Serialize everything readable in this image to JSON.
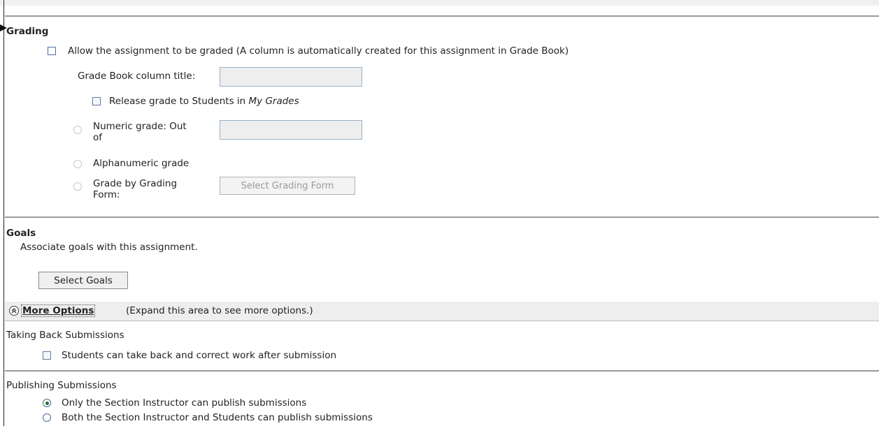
{
  "grading": {
    "heading": "Grading",
    "allow_label": "Allow the assignment to be graded (A column is automatically created for this assignment in Grade Book)",
    "column_title_label": "Grade Book column title:",
    "column_title_value": "",
    "release_prefix": "Release grade to Students in ",
    "release_italic": "My Grades",
    "numeric_line1": "Numeric grade: Out",
    "numeric_line2": "of",
    "numeric_value": "",
    "alphanumeric_label": "Alphanumeric grade",
    "grading_form_line1": "Grade by Grading",
    "grading_form_line2": "Form:",
    "select_grading_form_button": "Select Grading Form"
  },
  "goals": {
    "heading": "Goals",
    "description": "Associate goals with this assignment.",
    "select_goals_button": "Select Goals"
  },
  "more_options": {
    "link": "More Options",
    "note": "(Expand this area to see more options.)"
  },
  "taking_back": {
    "heading": "Taking Back Submissions",
    "checkbox_label": "Students can take back and correct work after submission"
  },
  "publishing": {
    "heading": "Publishing Submissions",
    "option_instructor": "Only the Section Instructor can publish submissions",
    "option_both": "Both the Section Instructor and Students can publish submissions",
    "selected": "option_instructor"
  }
}
